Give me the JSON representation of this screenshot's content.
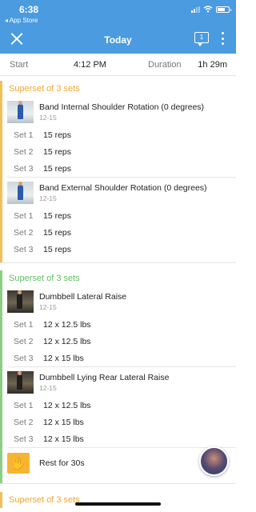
{
  "status": {
    "time": "6:38",
    "back_label": "◂ App Store"
  },
  "nav": {
    "title": "Today",
    "comments_count": "1"
  },
  "summary": {
    "start_label": "Start",
    "start_value": "4:12 PM",
    "duration_label": "Duration",
    "duration_value": "1h 29m"
  },
  "colors": {
    "header": "#4a9be0",
    "superset_orange": "#f0a730",
    "superset_green": "#5fbf63",
    "rest": "#f5b533"
  },
  "groups": [
    {
      "title": "Superset of 3 sets",
      "exercises": [
        {
          "name": "Band Internal Shoulder Rotation (0 degrees)",
          "sub": "12-15",
          "sets": [
            {
              "label": "Set 1",
              "value": "15 reps"
            },
            {
              "label": "Set 2",
              "value": "15 reps"
            },
            {
              "label": "Set 3",
              "value": "15 reps"
            }
          ]
        },
        {
          "name": "Band External Shoulder Rotation (0 degrees)",
          "sub": "12-15",
          "sets": [
            {
              "label": "Set 1",
              "value": "15 reps"
            },
            {
              "label": "Set 2",
              "value": "15 reps"
            },
            {
              "label": "Set 3",
              "value": "15 reps"
            }
          ]
        }
      ]
    },
    {
      "title": "Superset of 3 sets",
      "exercises": [
        {
          "name": "Dumbbell Lateral Raise",
          "sub": "12-15",
          "sets": [
            {
              "label": "Set 1",
              "value": "12 x 12.5 lbs"
            },
            {
              "label": "Set 2",
              "value": "12 x 12.5 lbs"
            },
            {
              "label": "Set 3",
              "value": "12 x 15 lbs"
            }
          ]
        },
        {
          "name": "Dumbbell Lying Rear Lateral Raise",
          "sub": "12-15",
          "sets": [
            {
              "label": "Set 1",
              "value": "12 x 12.5 lbs"
            },
            {
              "label": "Set 2",
              "value": "12 x 15 lbs"
            },
            {
              "label": "Set 3",
              "value": "12 x 15 lbs"
            }
          ]
        }
      ],
      "rest": {
        "icon": "hand-icon",
        "label": "Rest for 30s"
      }
    },
    {
      "title": "Superset of 3 sets"
    }
  ]
}
